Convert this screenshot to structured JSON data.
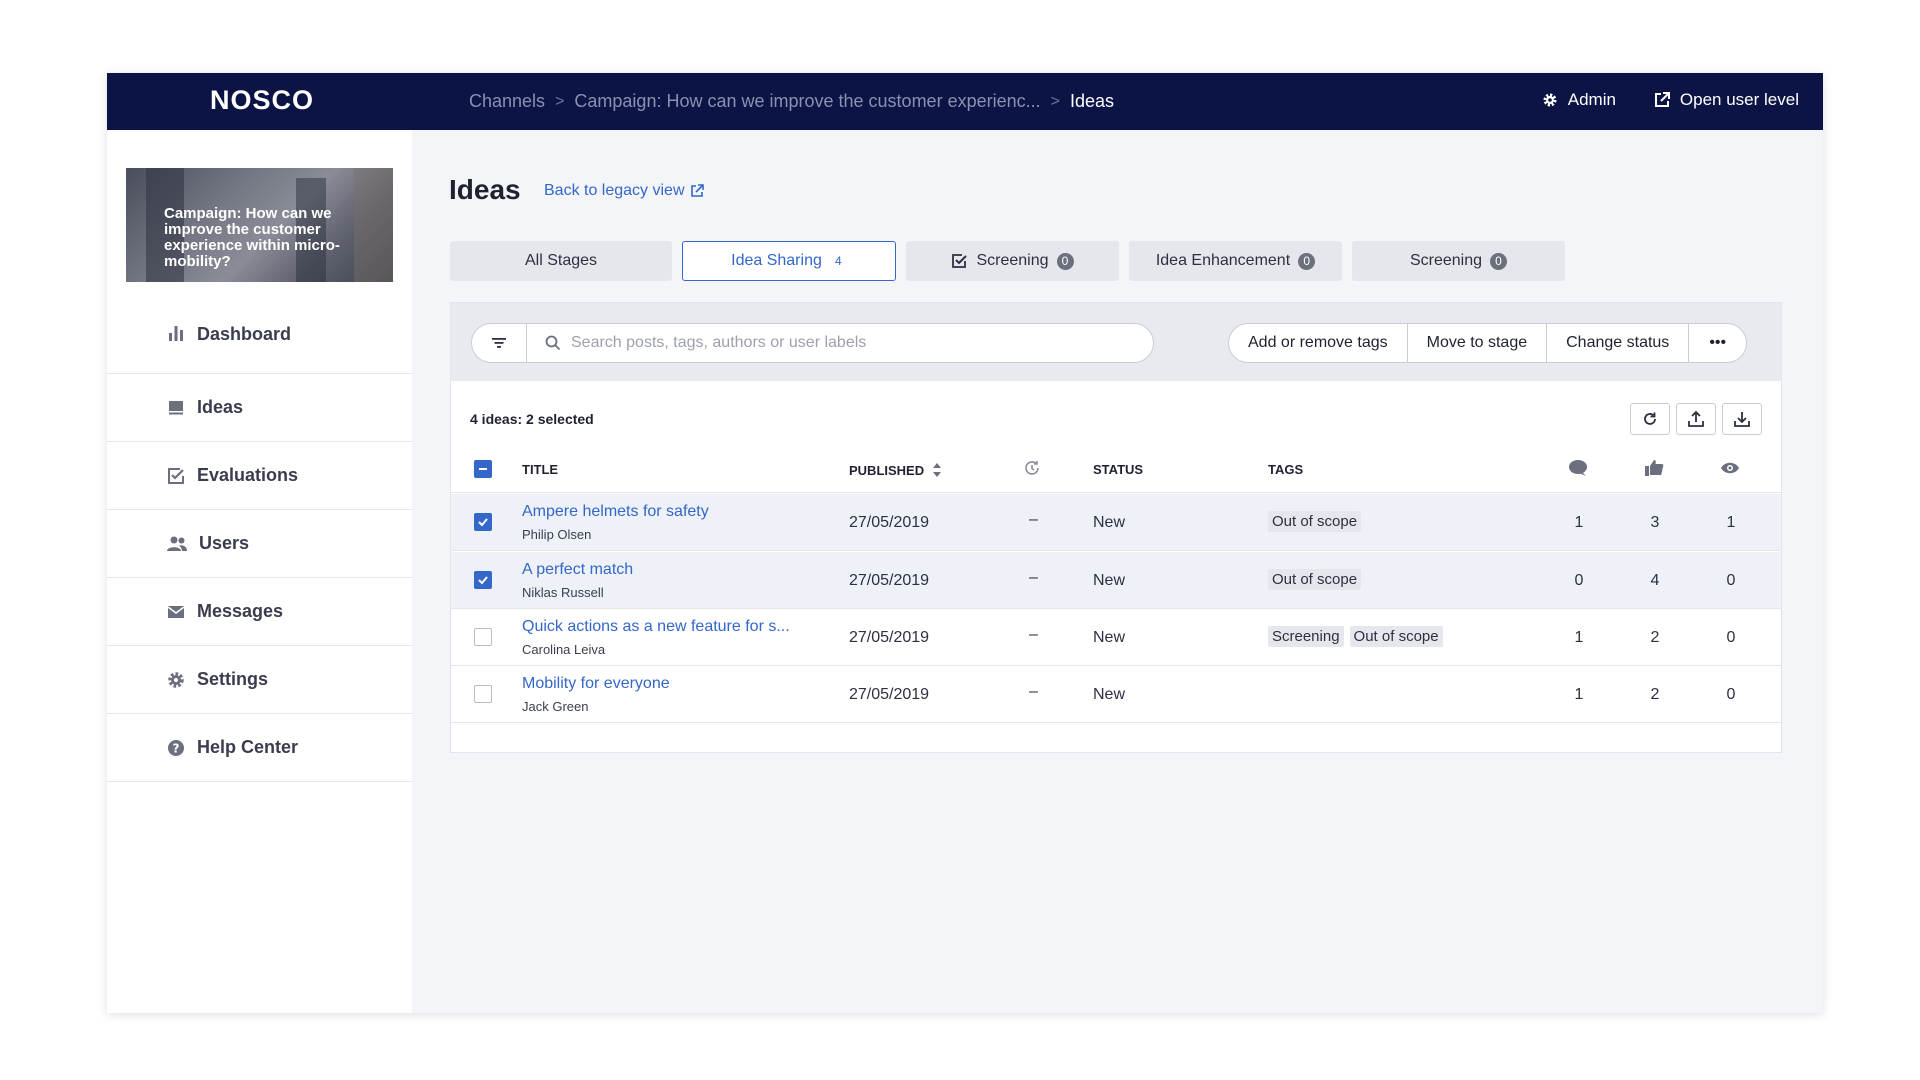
{
  "app": {
    "logo": "NOSCO"
  },
  "breadcrumb": {
    "items": [
      "Channels",
      "Campaign: How can we improve the customer experienc...",
      "Ideas"
    ],
    "separator": ">"
  },
  "top_actions": {
    "admin": "Admin",
    "open_user_level": "Open user level"
  },
  "campaign_card": {
    "text": "Campaign: How can we improve the customer experience within micro-mobility?"
  },
  "sidebar": {
    "items": [
      {
        "label": "Dashboard",
        "icon": "bar-chart-icon"
      },
      {
        "label": "Ideas",
        "icon": "ideas-icon"
      },
      {
        "label": "Evaluations",
        "icon": "checkbox-icon"
      },
      {
        "label": "Users",
        "icon": "users-icon"
      },
      {
        "label": "Messages",
        "icon": "envelope-icon"
      },
      {
        "label": "Settings",
        "icon": "gear-icon"
      },
      {
        "label": "Help Center",
        "icon": "help-icon"
      }
    ]
  },
  "page": {
    "title": "Ideas",
    "legacy_link": "Back to legacy view"
  },
  "tabs": [
    {
      "label": "All Stages",
      "count": ""
    },
    {
      "label": "Idea Sharing",
      "count": "4"
    },
    {
      "label": "Screening",
      "count": "0"
    },
    {
      "label": "Idea Enhancement",
      "count": "0"
    },
    {
      "label": "Screening",
      "count": "0"
    }
  ],
  "search": {
    "placeholder": "Search posts, tags, authors or user labels"
  },
  "bulk_actions": {
    "tags": "Add or remove tags",
    "move": "Move to stage",
    "status": "Change status",
    "more": "•••"
  },
  "summary": "4 ideas: 2 selected",
  "table": {
    "headers": {
      "title": "TITLE",
      "published": "PUBLISHED",
      "status": "STATUS",
      "tags": "TAGS"
    },
    "rows": [
      {
        "title": "Ampere helmets for safety",
        "author": "Philip Olsen",
        "date": "27/05/2019",
        "stage_time": "–",
        "status": "New",
        "tags": [
          "Out of scope"
        ],
        "comments": "1",
        "likes": "3",
        "views": "1",
        "selected": true
      },
      {
        "title": "A perfect match",
        "author": "Niklas Russell",
        "date": "27/05/2019",
        "stage_time": "–",
        "status": "New",
        "tags": [
          "Out of scope"
        ],
        "comments": "0",
        "likes": "4",
        "views": "0",
        "selected": true
      },
      {
        "title": "Quick actions as a new feature for s...",
        "author": "Carolina Leiva",
        "date": "27/05/2019",
        "stage_time": "–",
        "status": "New",
        "tags": [
          "Screening",
          "Out of scope"
        ],
        "comments": "1",
        "likes": "2",
        "views": "0",
        "selected": false
      },
      {
        "title": "Mobility for everyone",
        "author": "Jack Green",
        "date": "27/05/2019",
        "stage_time": "–",
        "status": "New",
        "tags": [],
        "comments": "1",
        "likes": "2",
        "views": "0",
        "selected": false
      }
    ]
  },
  "colors": {
    "topbar": "#0c1446",
    "accent": "#3367c9",
    "background": "#f4f5f8"
  }
}
